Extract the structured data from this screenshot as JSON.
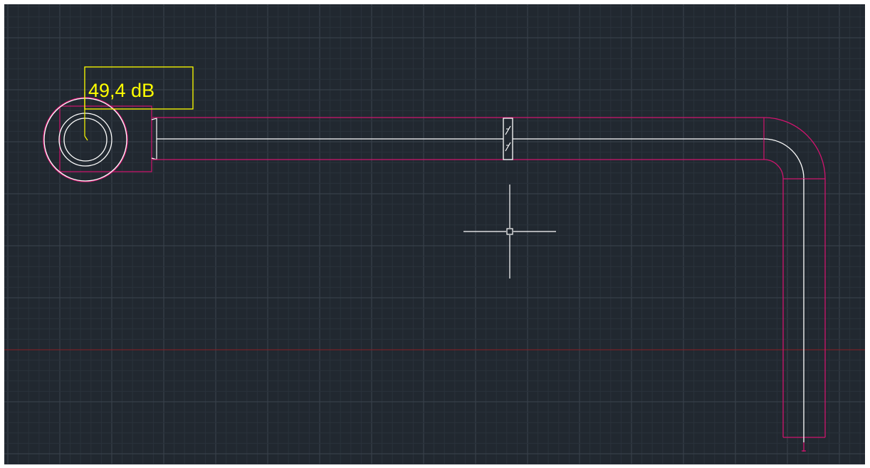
{
  "colors": {
    "canvas_background": "#212830",
    "grid_minor": "#2a323b",
    "grid_major": "#3a434e",
    "axis_line": "#8b1e24",
    "pipe_outline": "#d0146e",
    "pipe_centerline": "#ffffff",
    "label_color": "#ffff00",
    "crosshair": "#ffffff"
  },
  "annotation": {
    "label": "49,4 dB"
  },
  "icons": {
    "crosshair": "crosshair-cursor-icon",
    "duct_symbol": "damper-symbol-icon"
  }
}
